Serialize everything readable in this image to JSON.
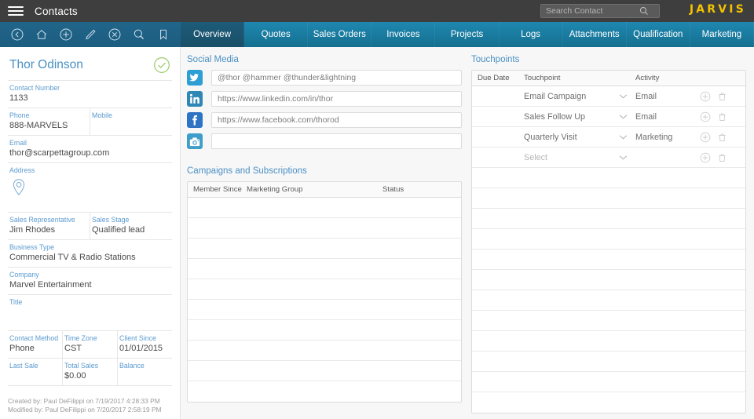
{
  "header": {
    "menu_icon": "hamburger-icon",
    "title": "Contacts",
    "search": {
      "placeholder": "Search Contact",
      "value": "",
      "icon": "search-icon"
    },
    "brand": "JARVIS",
    "brand_color": "#f2c200",
    "background_color": "#3e3e3e"
  },
  "toolbar": {
    "icons": [
      {
        "name": "back-icon",
        "label": "Back"
      },
      {
        "name": "home-icon",
        "label": "Home"
      },
      {
        "name": "add-icon",
        "label": "Add"
      },
      {
        "name": "edit-icon",
        "label": "Edit"
      },
      {
        "name": "cancel-icon",
        "label": "Cancel"
      },
      {
        "name": "search-icon",
        "label": "Search"
      },
      {
        "name": "bookmark-icon",
        "label": "Bookmark"
      }
    ]
  },
  "tabs": [
    {
      "label": "Overview",
      "active": true
    },
    {
      "label": "Quotes",
      "active": false
    },
    {
      "label": "Sales Orders",
      "active": false
    },
    {
      "label": "Invoices",
      "active": false
    },
    {
      "label": "Projects",
      "active": false
    },
    {
      "label": "Logs",
      "active": false
    },
    {
      "label": "Attachments",
      "active": false
    },
    {
      "label": "Qualification",
      "active": false
    },
    {
      "label": "Marketing",
      "active": false
    }
  ],
  "sidebar": {
    "contact_name": "Thor Odinson",
    "status_icon": "check-circle-icon",
    "status_color": "#9bcb66",
    "fields": {
      "contact_number": {
        "label": "Contact Number",
        "value": "1133"
      },
      "phone": {
        "label": "Phone",
        "value": "888-MARVELS"
      },
      "mobile": {
        "label": "Mobile",
        "value": ""
      },
      "email": {
        "label": "Email",
        "value": "thor@scarpettagroup.com"
      },
      "address": {
        "label": "Address",
        "value": "",
        "icon": "map-pin-icon"
      },
      "sales_representative": {
        "label": "Sales Representative",
        "value": "Jim Rhodes"
      },
      "sales_stage": {
        "label": "Sales Stage",
        "value": "Qualified lead"
      },
      "business_type": {
        "label": "Business Type",
        "value": "Commercial TV & Radio Stations"
      },
      "company": {
        "label": "Company",
        "value": "Marvel Entertainment"
      },
      "title": {
        "label": "Title",
        "value": ""
      },
      "contact_method": {
        "label": "Contact Method",
        "value": "Phone"
      },
      "time_zone": {
        "label": "Time Zone",
        "value": "CST"
      },
      "client_since": {
        "label": "Client Since",
        "value": "01/01/2015"
      },
      "last_sale": {
        "label": "Last Sale",
        "value": ""
      },
      "total_sales": {
        "label": "Total Sales",
        "value": "$0.00"
      },
      "balance": {
        "label": "Balance",
        "value": ""
      }
    },
    "footer": {
      "created": "Created by: Paul DeFilippi on 7/19/2017 4:28:33 PM",
      "modified": "Modified by: Paul DeFilippi on 7/20/2017 2:58:19 PM"
    }
  },
  "social_media": {
    "title": "Social Media",
    "rows": [
      {
        "icon": "twitter-icon",
        "color": "#2e9fd4",
        "value": "@thor @hammer @thunder&lightning",
        "placeholder": ""
      },
      {
        "icon": "linkedin-icon",
        "color": "#2e87b5",
        "value": "https://www.linkedin.com/in/thor",
        "placeholder": ""
      },
      {
        "icon": "facebook-icon",
        "color": "#2d74c4",
        "value": "https://www.facebook.com/thorod",
        "placeholder": ""
      },
      {
        "icon": "instagram-icon",
        "color": "#3e9dc9",
        "value": "",
        "placeholder": ""
      }
    ]
  },
  "campaigns": {
    "title": "Campaigns and Subscriptions",
    "columns": [
      "Member Since",
      "Marketing Group",
      "Status"
    ],
    "rows": [],
    "empty_row_count": 10
  },
  "touchpoints": {
    "title": "Touchpoints",
    "columns": [
      "Due Date",
      "Touchpoint",
      "Activity"
    ],
    "rows": [
      {
        "due_date": "",
        "touchpoint": "Email Campaign",
        "activity": "Email",
        "placeholder": false
      },
      {
        "due_date": "",
        "touchpoint": "Sales Follow Up",
        "activity": "Email",
        "placeholder": false
      },
      {
        "due_date": "",
        "touchpoint": "Quarterly Visit",
        "activity": "Marketing",
        "placeholder": false
      },
      {
        "due_date": "",
        "touchpoint": "Select",
        "activity": "",
        "placeholder": true
      }
    ],
    "empty_row_count": 12,
    "row_icons": {
      "add": "add-circle-icon",
      "delete": "trash-icon",
      "dropdown": "chevron-down-icon"
    }
  }
}
